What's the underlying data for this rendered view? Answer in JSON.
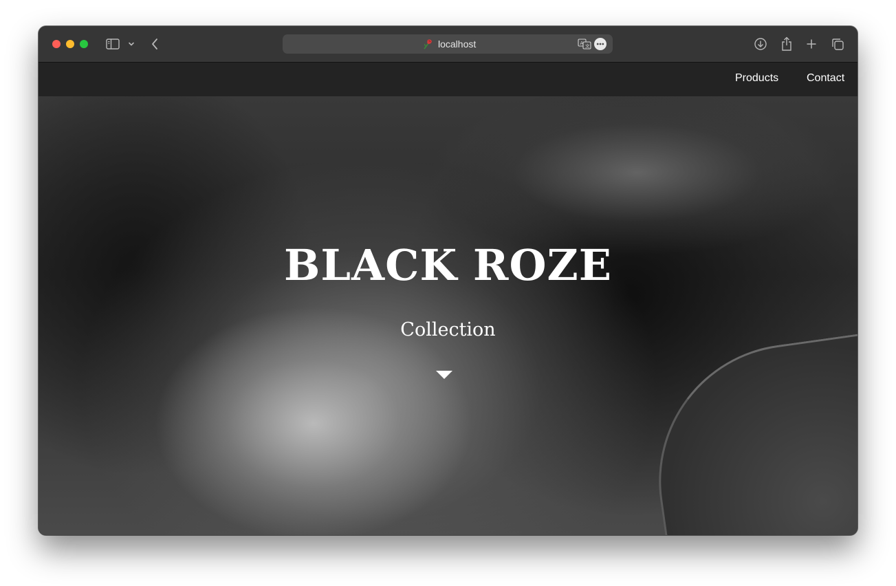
{
  "browser": {
    "url": "localhost",
    "icons": {
      "sidebar": "sidebar-icon",
      "sidebar_menu": "chevron-down-icon",
      "back": "chevron-left-icon",
      "favicon": "rose-icon",
      "translate": "translate-icon",
      "more": "ellipsis-icon",
      "downloads": "download-icon",
      "share": "share-icon",
      "new_tab": "plus-icon",
      "tabs": "tabs-overview-icon"
    }
  },
  "nav": {
    "items": [
      {
        "label": "Products"
      },
      {
        "label": "Contact"
      }
    ]
  },
  "hero": {
    "title": "BLACK ROZE",
    "subtitle": "Collection",
    "scroll_icon": "triangle-down-icon"
  },
  "colors": {
    "nav_background": "#232323",
    "text": "#ffffff",
    "close": "#fe5f57",
    "minimize": "#febc2e",
    "zoom": "#28c840"
  }
}
